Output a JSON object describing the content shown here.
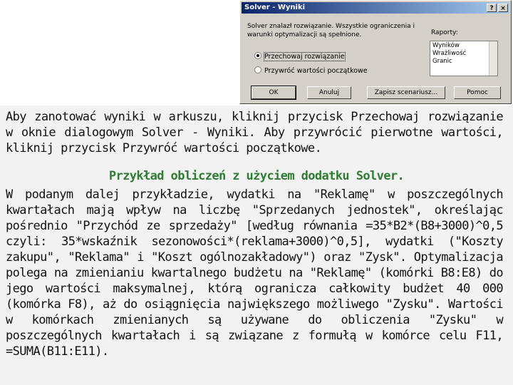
{
  "dialog": {
    "title": "Solver - Wyniki",
    "help_btn": "?",
    "close_btn": "×",
    "message_line1": "Solver znalazł rozwiązanie. Wszystkie ograniczenia i",
    "message_line2": "warunki optymalizacji są spełnione.",
    "option_keep": "Przechowaj rozwiązanie",
    "option_restore": "Przywróć wartości początkowe",
    "reports_label": "Raporty:",
    "reports": [
      "Wyników",
      "Wrażliwość",
      "Granic"
    ],
    "buttons": {
      "ok": "OK",
      "cancel": "Anuluj",
      "save_scenario": "Zapisz scenariusz...",
      "help": "Pomoc"
    }
  },
  "text": {
    "intro": "Aby zanotować wyniki w arkuszu, kliknij przycisk Przechowaj rozwiązanie w oknie dialogowym Solver - Wyniki. Aby przywrócić pierwotne wartości, kliknij przycisk Przywróć wartości początkowe.",
    "heading": "Przykład obliczeń z użyciem dodatku Solver.",
    "body": "W podanym dalej przykładzie, wydatki na \"Reklamę\" w poszczególnych kwartałach mają wpływ na liczbę \"Sprzedanych jednostek\", określając pośrednio \"Przychód ze sprzedaży\" [według równania =35*B2*(B8+3000)^0,5 czyli: 35*wskaźnik sezonowości*(reklama+3000)^0,5], wydatki (\"Koszty zakupu\", \"Reklama\" i \"Koszt ogólnozakładowy\") oraz \"Zysk\". Optymalizacja polega na zmienianiu kwartalnego budżetu na \"Reklamę\" (komórki B8:E8) do jego wartości maksymalnej, którą ogranicza całkowity budżet 40 000 (komórka F8), aż do osiągnięcia największego możliwego \"Zysku\". Wartości w komórkach zmienianych są używane do obliczenia \"Zysku\" w poszczególnych kwartałach i są związane z formułą w komórce celu F11, =SUMA(B11:E11)."
  }
}
